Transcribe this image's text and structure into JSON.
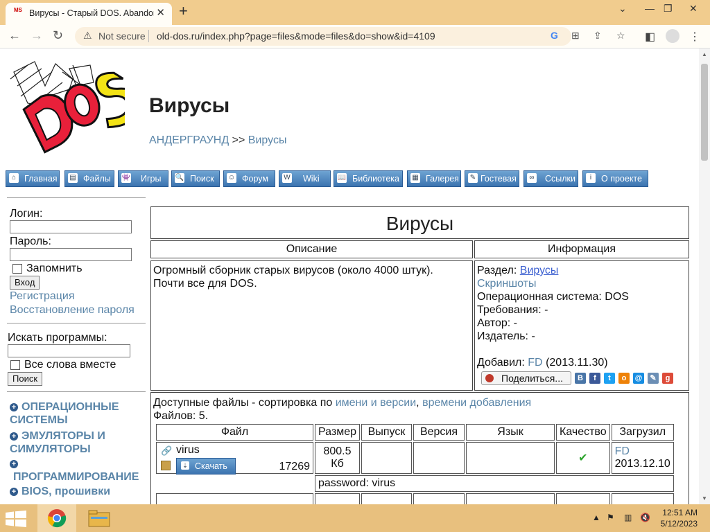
{
  "browser": {
    "tab_title": "Вирусы - Старый DOS. Abandonware",
    "tab_favicon": "MS",
    "not_secure_label": "Not secure",
    "url": "old-dos.ru/index.php?page=files&mode=files&do=show&id=4109"
  },
  "header": {
    "logo_text": "MS DOS",
    "title": "Вирусы",
    "breadcrumb_parent": "АНДЕРГРАУНД",
    "breadcrumb_sep": ">>",
    "breadcrumb_current": "Вирусы"
  },
  "nav": [
    {
      "label": "Главная",
      "icon": "home-icon"
    },
    {
      "label": "Файлы",
      "icon": "files-icon"
    },
    {
      "label": "Игры",
      "icon": "games-icon"
    },
    {
      "label": "Поиск",
      "icon": "search-icon"
    },
    {
      "label": "Форум",
      "icon": "forum-icon"
    },
    {
      "label": "Wiki",
      "icon": "wiki-icon"
    },
    {
      "label": "Библиотека",
      "icon": "library-icon"
    },
    {
      "label": "Галерея",
      "icon": "gallery-icon"
    },
    {
      "label": "Гостевая",
      "icon": "guestbook-icon"
    },
    {
      "label": "Ссылки",
      "icon": "links-icon"
    },
    {
      "label": "О проекте",
      "icon": "info-icon"
    }
  ],
  "sidebar": {
    "login_label": "Логин:",
    "password_label": "Пароль:",
    "remember_label": "Запомнить",
    "login_button": "Вход",
    "register_link": "Регистрация",
    "restore_link": "Восстановление пароля",
    "search_label": "Искать программы:",
    "all_words_label": "Все слова вместе",
    "search_button": "Поиск",
    "categories": [
      "ОПЕРАЦИОННЫЕ СИСТЕМЫ",
      "ЭМУЛЯТОРЫ И СИМУЛЯТОРЫ",
      "ПРОГРАММИРОВАНИЕ",
      "BIOS, прошивки"
    ]
  },
  "main": {
    "title": "Вирусы",
    "desc_header": "Описание",
    "info_header": "Информация",
    "description_line1": "Огромный сборник старых вирусов (около 4000 штук).",
    "description_line2": "Почти все для DOS.",
    "info": {
      "section_label": "Раздел:",
      "section_link": "Вирусы",
      "screenshots_link": "Скриншоты",
      "os": "Операционная система: DOS",
      "requirements": "Требования: -",
      "author": "Автор: -",
      "publisher": "Издатель: -",
      "added_label": "Добавил:",
      "added_user": "FD",
      "added_date": "(2013.11.30)",
      "share_label": "Поделиться..."
    },
    "files": {
      "available_prefix": "Доступные файлы - сортировка по",
      "sort_name_link": "имени и версии",
      "sort_time_link": "времени добавления",
      "count_text": "Файлов: 5.",
      "columns": [
        "Файл",
        "Размер",
        "Выпуск",
        "Версия",
        "Язык",
        "Качество",
        "Загрузил"
      ],
      "row": {
        "name": "virus",
        "download_label": "Скачать",
        "downloads": "17269",
        "size": "800.5 Кб",
        "uploader": "FD",
        "date": "2013.12.10",
        "password_note": "password: virus"
      }
    }
  },
  "taskbar": {
    "time": "12:51 AM",
    "date": "5/12/2023"
  }
}
